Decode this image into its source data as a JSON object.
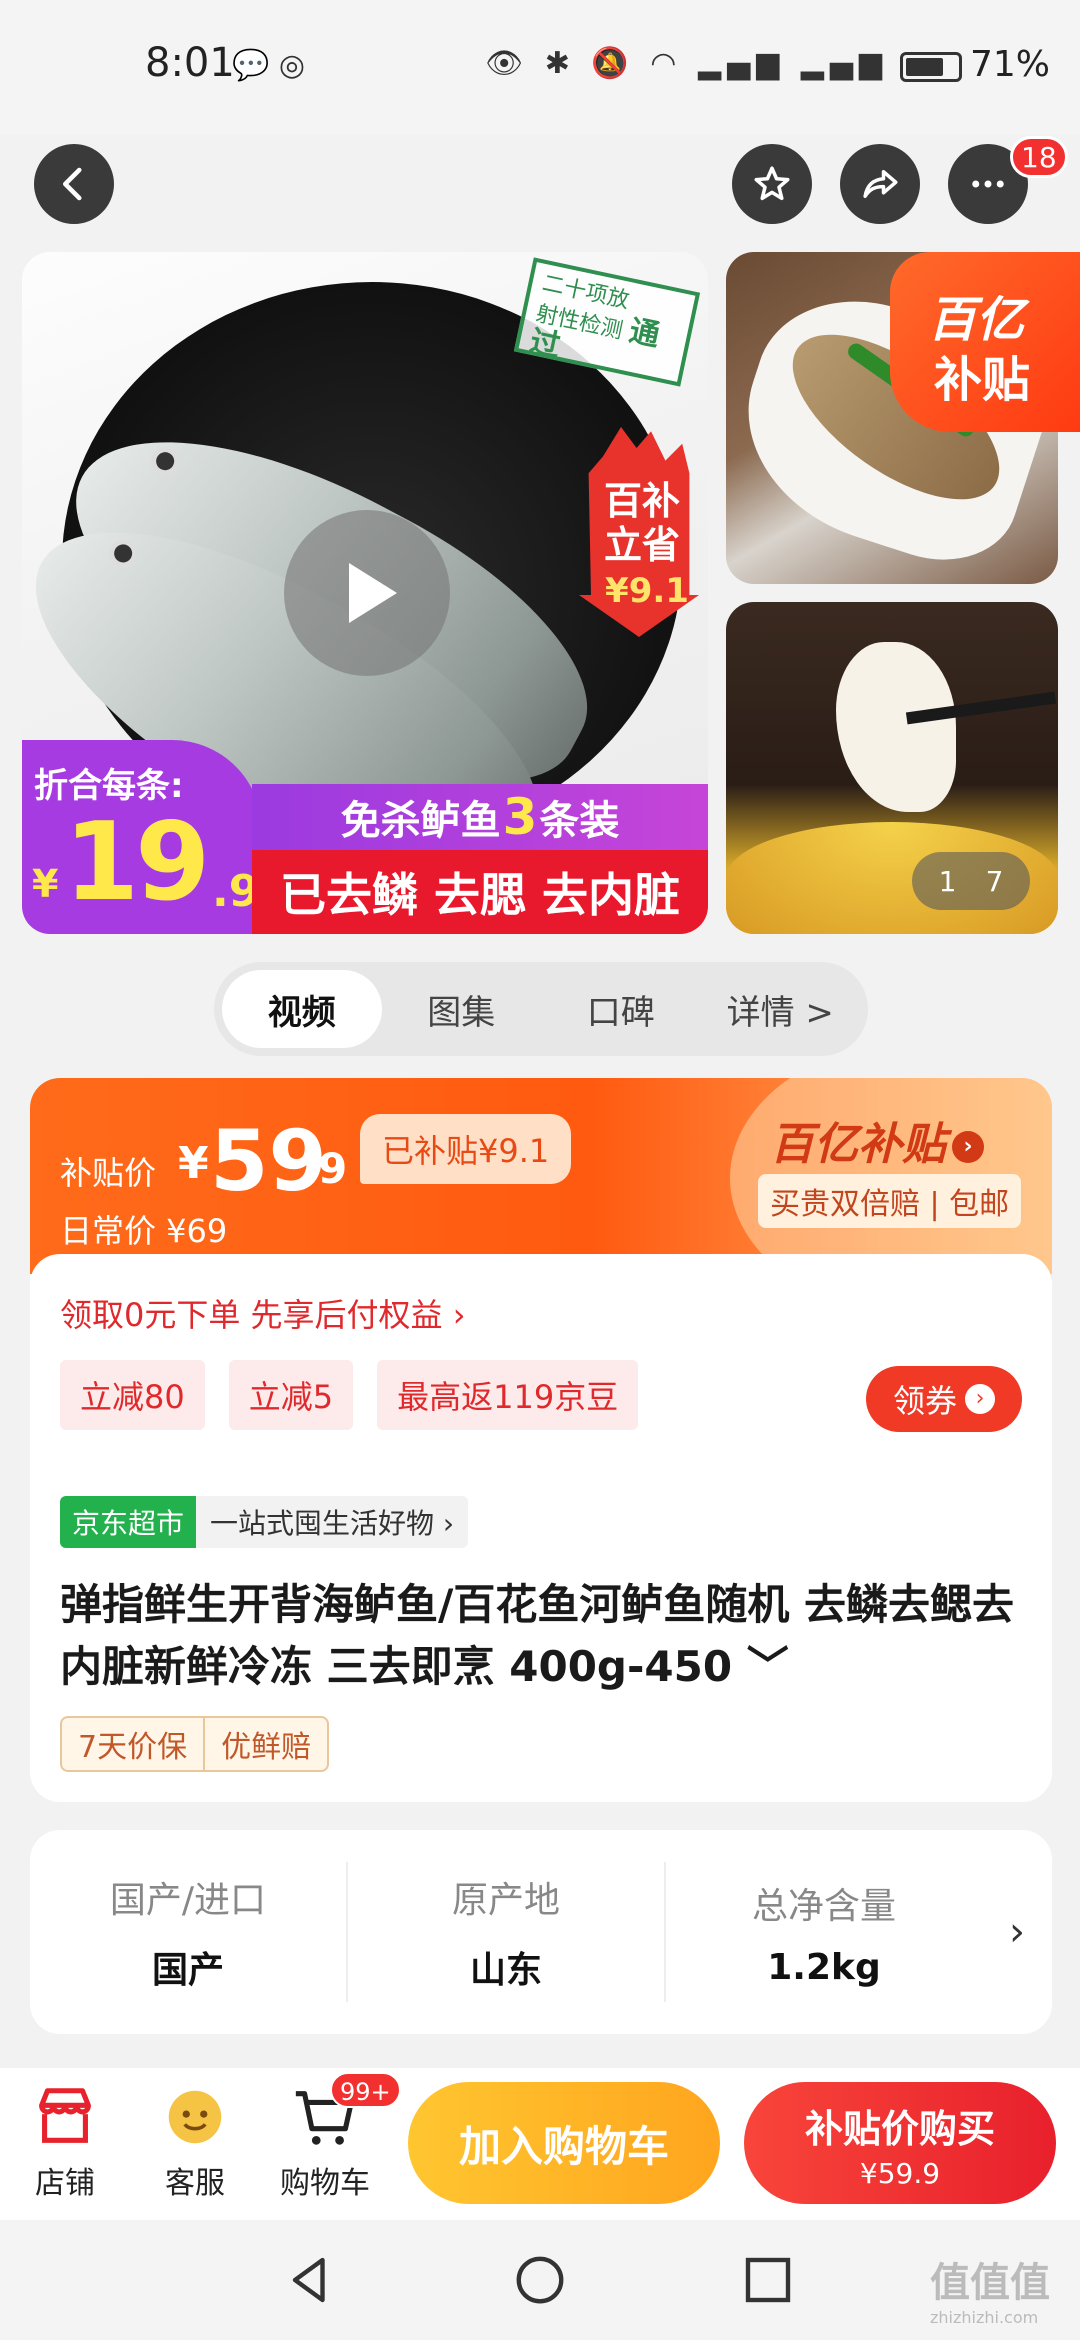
{
  "status_bar": {
    "time": "8:01",
    "battery": "71%",
    "battery_level": 0.71
  },
  "nav": {
    "badge_count": "18"
  },
  "gallery": {
    "stamp_line1": "二十项放",
    "stamp_line2": "射性检测",
    "stamp_pass": "通过",
    "promo_line1": "百补",
    "promo_line2": "立省",
    "promo_amount": "¥9.1",
    "per_item_label": "折合每条:",
    "per_item_currency": "¥",
    "per_item_int": "19",
    "per_item_dec": ".9",
    "banner_pre": "免杀鲈鱼",
    "banner_num": "3",
    "banner_post": "条装",
    "banner_line2": "已去鳞 去腮 去内脏",
    "subsidy_line1": "百亿",
    "subsidy_line2": "补贴",
    "pager_current": "1",
    "pager_total": "7"
  },
  "tabs": [
    {
      "label": "视频"
    },
    {
      "label": "图集"
    },
    {
      "label": "口碑"
    },
    {
      "label": "详情 >"
    }
  ],
  "price": {
    "label": "补贴价",
    "currency": "¥",
    "int": "59",
    "dec": ".9",
    "subsidized": "已补贴¥9.1",
    "daily_label": "日常价 ¥69",
    "brand": "百亿补贴",
    "brand_tag": "买贵双倍赔 | 包邮",
    "colors": {
      "accent": "#ff5a10",
      "red": "#e0292c"
    }
  },
  "offers": {
    "pay_later": "领取0元下单 先享后付权益 ›",
    "coupons": [
      "立减80",
      "立减5",
      "最高返119京豆"
    ],
    "get_coupon": "领券"
  },
  "store": {
    "name": "京东超市",
    "slogan": "一站式囤生活好物 ›"
  },
  "product": {
    "title": "弹指鲜生开背海鲈鱼/百花鱼河鲈鱼随机 去鳞去鳃去内脏新鲜冷冻 三去即烹 400g-450 ﹀",
    "guarantees": [
      "7天价保",
      "优鲜赔"
    ]
  },
  "specs": [
    {
      "key": "国产/进口",
      "value": "国产"
    },
    {
      "key": "原产地",
      "value": "山东"
    },
    {
      "key": "总净含量",
      "value": "1.2kg"
    }
  ],
  "bottom_bar": {
    "store": "店铺",
    "service": "客服",
    "cart": "购物车",
    "cart_badge": "99+",
    "add_cart": "加入购物车",
    "buy": "补贴价购买",
    "buy_price": "¥59.9"
  },
  "watermark": {
    "text": "值值值",
    "url": "zhizhizhi.com"
  }
}
